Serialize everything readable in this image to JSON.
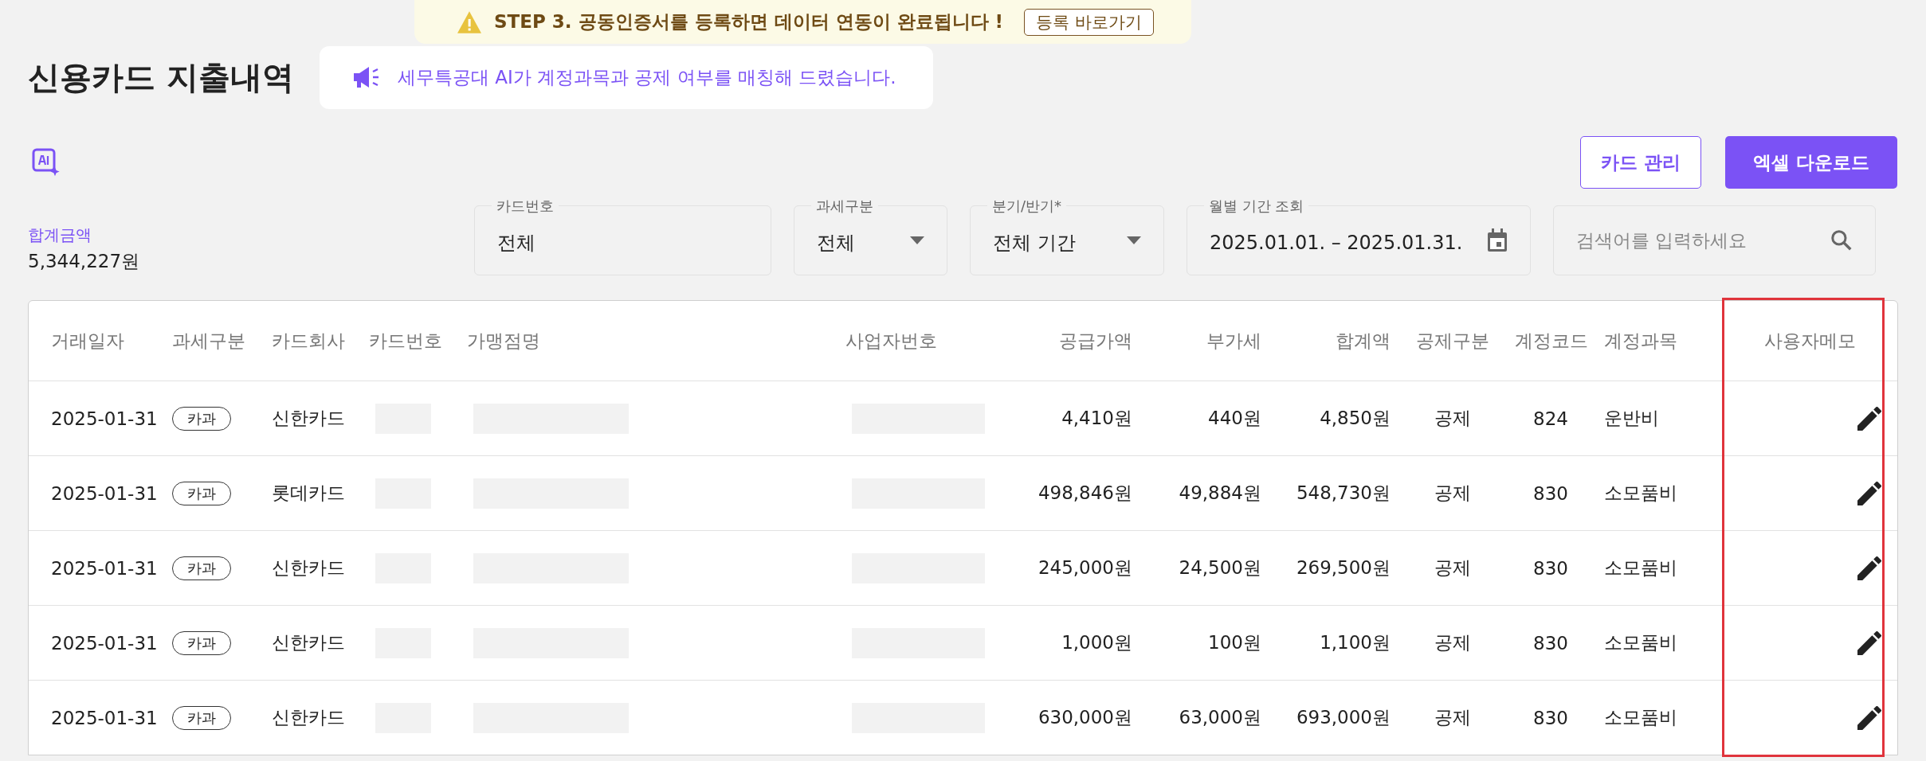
{
  "banner": {
    "message": "STEP 3. 공동인증서를 등록하면 데이터 연동이 완료됩니다 !",
    "button": "등록 바로가기"
  },
  "title": "신용카드 지출내역",
  "notice": "세무특공대 AI가 계정과목과 공제 여부를 매칭해 드렸습니다.",
  "actions": [
    {
      "label": "카드 관리",
      "kind": "outline"
    },
    {
      "label": "엑셀 다운로드",
      "kind": "primary"
    }
  ],
  "summary": {
    "label": "합계금액",
    "value": "5,344,227원"
  },
  "filters": [
    {
      "kind": "text",
      "label": "카드번호",
      "value": "전체"
    },
    {
      "kind": "select",
      "label": "과세구분",
      "value": "전체"
    },
    {
      "kind": "select",
      "label": "분기/반기*",
      "value": "전체 기간"
    },
    {
      "kind": "date",
      "label": "월별 기간 조회",
      "value": "2025.01.01. – 2025.01.31."
    },
    {
      "kind": "search",
      "placeholder": "검색어를 입력하세요"
    }
  ],
  "table": {
    "memo_column_highlighted": true,
    "columns": [
      "거래일자",
      "과세구분",
      "카드회사",
      "카드번호",
      "가맹점명",
      "사업자번호",
      "공급가액",
      "부가세",
      "합계액",
      "공제구분",
      "계정코드",
      "계정과목",
      "사용자메모"
    ],
    "rows": [
      {
        "date": "2025-01-31",
        "tax_type": "카과",
        "card_company": "신한카드",
        "supply": "4,410원",
        "vat": "440원",
        "total": "4,850원",
        "deduction": "공제",
        "code": "824",
        "account": "운반비"
      },
      {
        "date": "2025-01-31",
        "tax_type": "카과",
        "card_company": "롯데카드",
        "supply": "498,846원",
        "vat": "49,884원",
        "total": "548,730원",
        "deduction": "공제",
        "code": "830",
        "account": "소모품비"
      },
      {
        "date": "2025-01-31",
        "tax_type": "카과",
        "card_company": "신한카드",
        "supply": "245,000원",
        "vat": "24,500원",
        "total": "269,500원",
        "deduction": "공제",
        "code": "830",
        "account": "소모품비"
      },
      {
        "date": "2025-01-31",
        "tax_type": "카과",
        "card_company": "신한카드",
        "supply": "1,000원",
        "vat": "100원",
        "total": "1,100원",
        "deduction": "공제",
        "code": "830",
        "account": "소모품비"
      },
      {
        "date": "2025-01-31",
        "tax_type": "카과",
        "card_company": "신한카드",
        "supply": "630,000원",
        "vat": "63,000원",
        "total": "693,000원",
        "deduction": "공제",
        "code": "830",
        "account": "소모품비"
      }
    ]
  }
}
